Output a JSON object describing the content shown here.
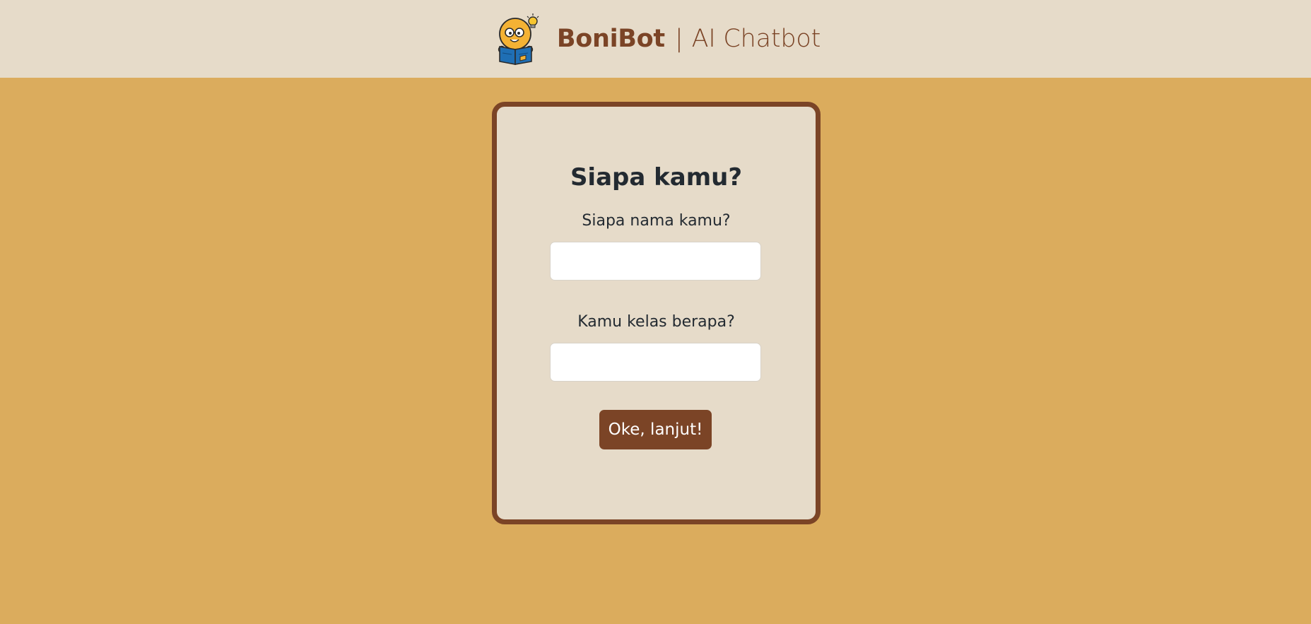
{
  "header": {
    "logo_icon": "reading-mascot-logo-icon",
    "brand_name": "BoniBot",
    "separator": "|",
    "subtitle": "AI Chatbot"
  },
  "form": {
    "title": "Siapa kamu?",
    "name_label": "Siapa nama kamu?",
    "name_value": "",
    "class_label": "Kamu kelas berapa?",
    "class_value": "",
    "submit_label": "Oke, lanjut!"
  },
  "colors": {
    "page_background": "#dbac5d",
    "header_background": "#e6dbc9",
    "card_background": "#e6dbc9",
    "accent_brown": "#7b4426",
    "text_dark": "#232a31"
  }
}
